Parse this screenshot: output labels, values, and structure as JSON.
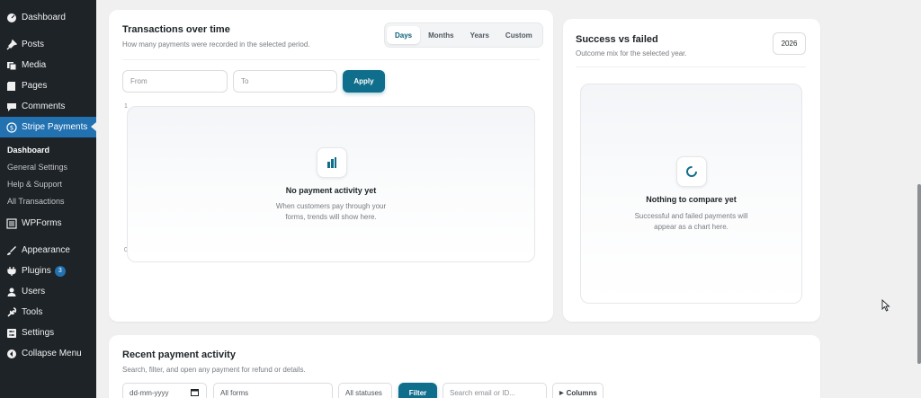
{
  "sidebar": {
    "items": [
      {
        "label": "Dashboard",
        "icon": "dashboard-icon"
      },
      {
        "label": "Posts",
        "icon": "pin-icon"
      },
      {
        "label": "Media",
        "icon": "media-icon"
      },
      {
        "label": "Pages",
        "icon": "pages-icon"
      },
      {
        "label": "Comments",
        "icon": "comments-icon"
      },
      {
        "label": "Stripe Payments",
        "icon": "dollar-icon"
      },
      {
        "label": "WPForms",
        "icon": "forms-icon"
      },
      {
        "label": "Appearance",
        "icon": "brush-icon"
      },
      {
        "label": "Plugins",
        "icon": "plugin-icon",
        "badge": "3"
      },
      {
        "label": "Users",
        "icon": "user-icon"
      },
      {
        "label": "Tools",
        "icon": "wrench-icon"
      },
      {
        "label": "Settings",
        "icon": "settings-icon"
      },
      {
        "label": "Collapse Menu",
        "icon": "collapse-icon"
      }
    ],
    "submenu": [
      "Dashboard",
      "General Settings",
      "Help & Support",
      "All Transactions"
    ]
  },
  "transactions": {
    "title": "Transactions over time",
    "subtitle": "How many payments were recorded in the selected period.",
    "periods": [
      "Days",
      "Months",
      "Years",
      "Custom"
    ],
    "from_placeholder": "From",
    "to_placeholder": "To",
    "apply_label": "Apply",
    "axis_top": "1",
    "axis_zero": "0",
    "empty_title": "No payment activity yet",
    "empty_text_1": "When customers pay through your",
    "empty_text_2": "forms, trends will show here."
  },
  "success": {
    "title": "Success vs failed",
    "subtitle": "Outcome mix for the selected year.",
    "year": "2026",
    "empty_title": "Nothing to compare yet",
    "empty_text_1": "Successful and failed payments will",
    "empty_text_2": "appear as a chart here."
  },
  "recent": {
    "title": "Recent payment activity",
    "subtitle": "Search, filter, and open any payment for refund or details.",
    "date_placeholder": "dd-mm-yyyy",
    "forms_value": "All forms",
    "statuses_value": "All statuses",
    "filter_label": "Filter",
    "search_placeholder": "Search email or ID...",
    "columns_label": "Columns"
  },
  "colors": {
    "accent": "#0f6e8c",
    "sidebar_bg": "#1d2327",
    "active_menu": "#2271b1"
  }
}
